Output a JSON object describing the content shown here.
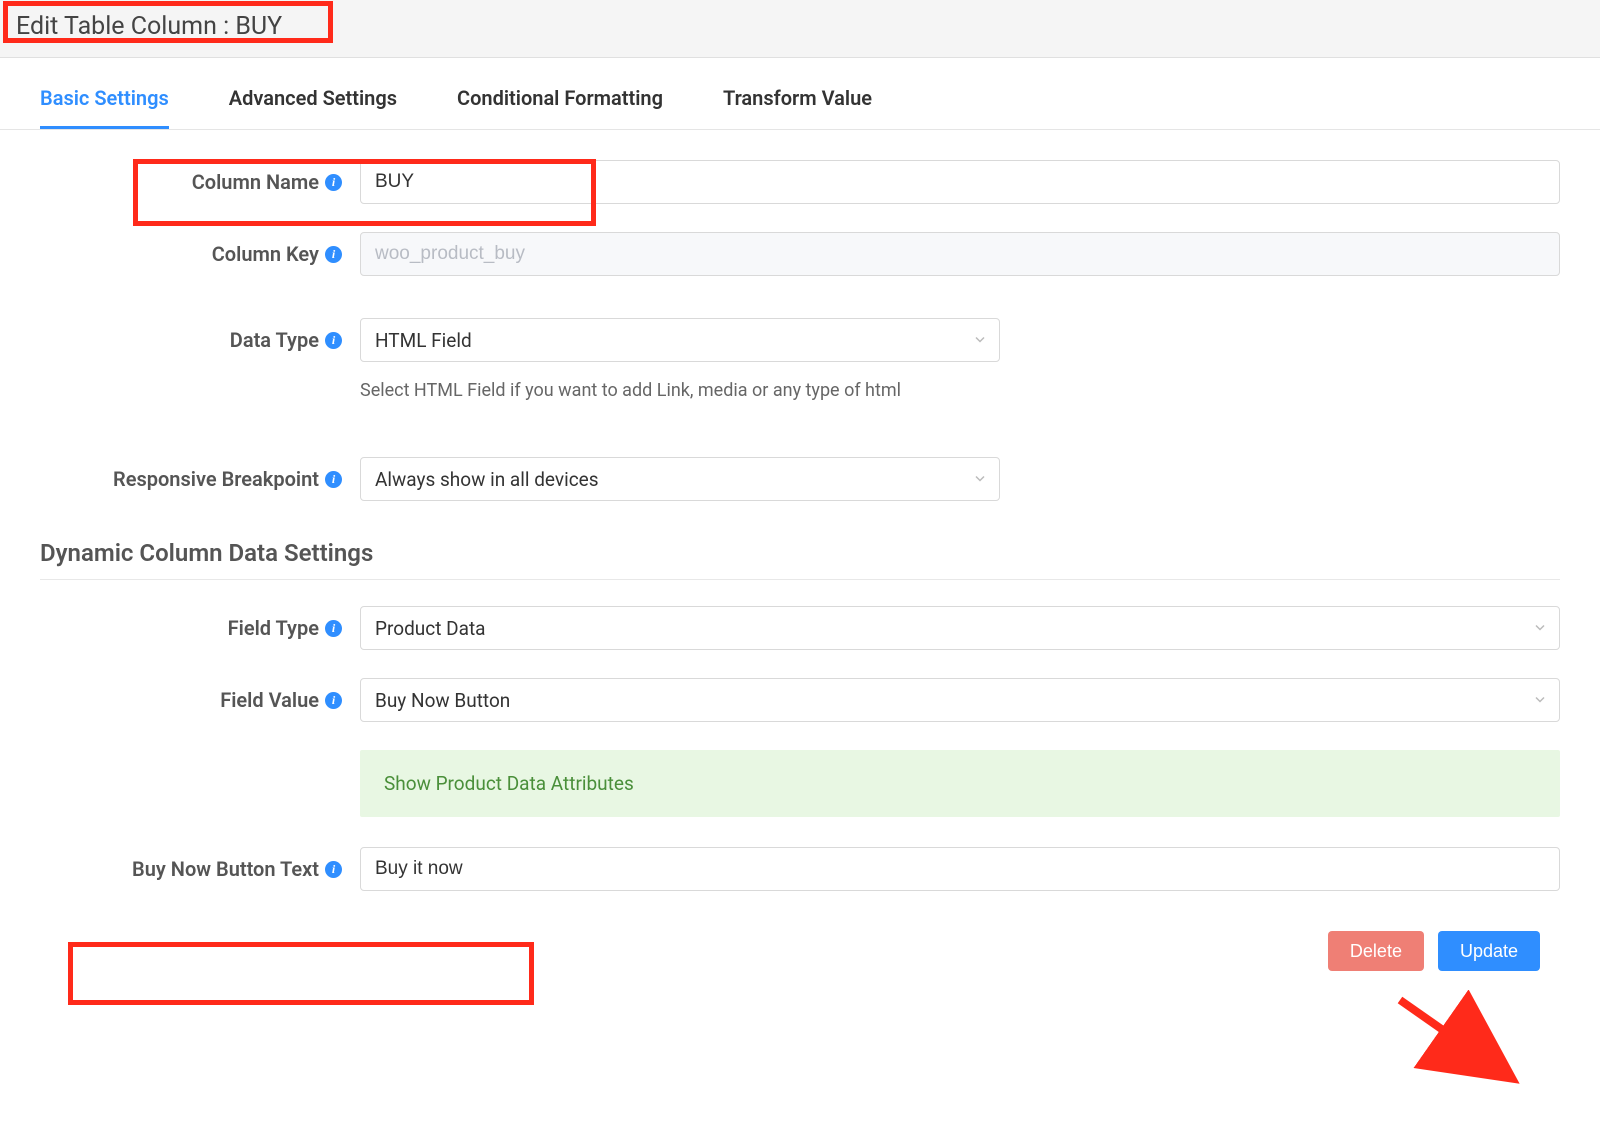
{
  "header": {
    "title": "Edit Table Column : BUY"
  },
  "tabs": {
    "basic": "Basic Settings",
    "advanced": "Advanced Settings",
    "conditional": "Conditional Formatting",
    "transform": "Transform Value"
  },
  "basic": {
    "column_name_label": "Column Name",
    "column_name_value": "BUY",
    "column_key_label": "Column Key",
    "column_key_value": "woo_product_buy",
    "data_type_label": "Data Type",
    "data_type_value": "HTML Field",
    "data_type_helper": "Select HTML Field if you want to add Link, media or any type of html",
    "responsive_label": "Responsive Breakpoint",
    "responsive_value": "Always show in all devices"
  },
  "dynamic": {
    "heading": "Dynamic Column Data Settings",
    "field_type_label": "Field Type",
    "field_type_value": "Product Data",
    "field_value_label": "Field Value",
    "field_value_value": "Buy Now Button",
    "attributes_notice": "Show Product Data Attributes",
    "buy_now_label": "Buy Now Button Text",
    "buy_now_value": "Buy it now"
  },
  "actions": {
    "delete": "Delete",
    "update": "Update"
  }
}
